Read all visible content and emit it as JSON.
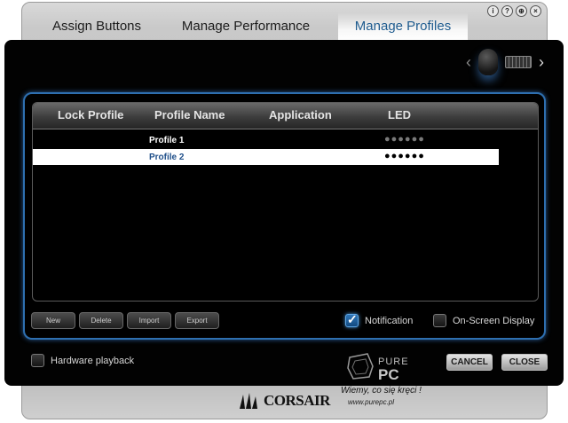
{
  "tabs": [
    {
      "label": "Assign Buttons",
      "active": false
    },
    {
      "label": "Manage Performance",
      "active": false
    },
    {
      "label": "Manage Profiles",
      "active": true
    }
  ],
  "window_controls": [
    "i",
    "?",
    "⊕",
    "×"
  ],
  "table": {
    "headers": [
      "Lock Profile",
      "Profile Name",
      "Application",
      "LED"
    ],
    "rows": [
      {
        "name": "Profile 1",
        "led": "●●●●●●",
        "selected": false
      },
      {
        "name": "Profile 2",
        "led": "●●●●●●",
        "selected": true
      }
    ]
  },
  "buttons": {
    "new": "New",
    "delete": "Delete",
    "import": "Import",
    "export": "Export",
    "cancel": "CANCEL",
    "close": "CLOSE"
  },
  "options": {
    "notification": {
      "label": "Notification",
      "checked": true
    },
    "osd": {
      "label": "On-Screen Display",
      "checked": false
    },
    "hardware_playback": {
      "label": "Hardware playback",
      "checked": false
    }
  },
  "watermark": {
    "brand": "PURE PC",
    "tagline": "Wiemy, co się kręci !",
    "url": "www.purepc.pl"
  },
  "logo": {
    "brand": "CORSAIR"
  },
  "colors": {
    "accent": "#2e6fb0",
    "active_tab_text": "#1f5c8f",
    "selected_row_text": "#1f4f8a"
  },
  "icons": {
    "nav_prev": "chevron-left-icon",
    "nav_next": "chevron-right-icon",
    "device1": "mouse-icon",
    "device2": "keyboard-icon"
  }
}
